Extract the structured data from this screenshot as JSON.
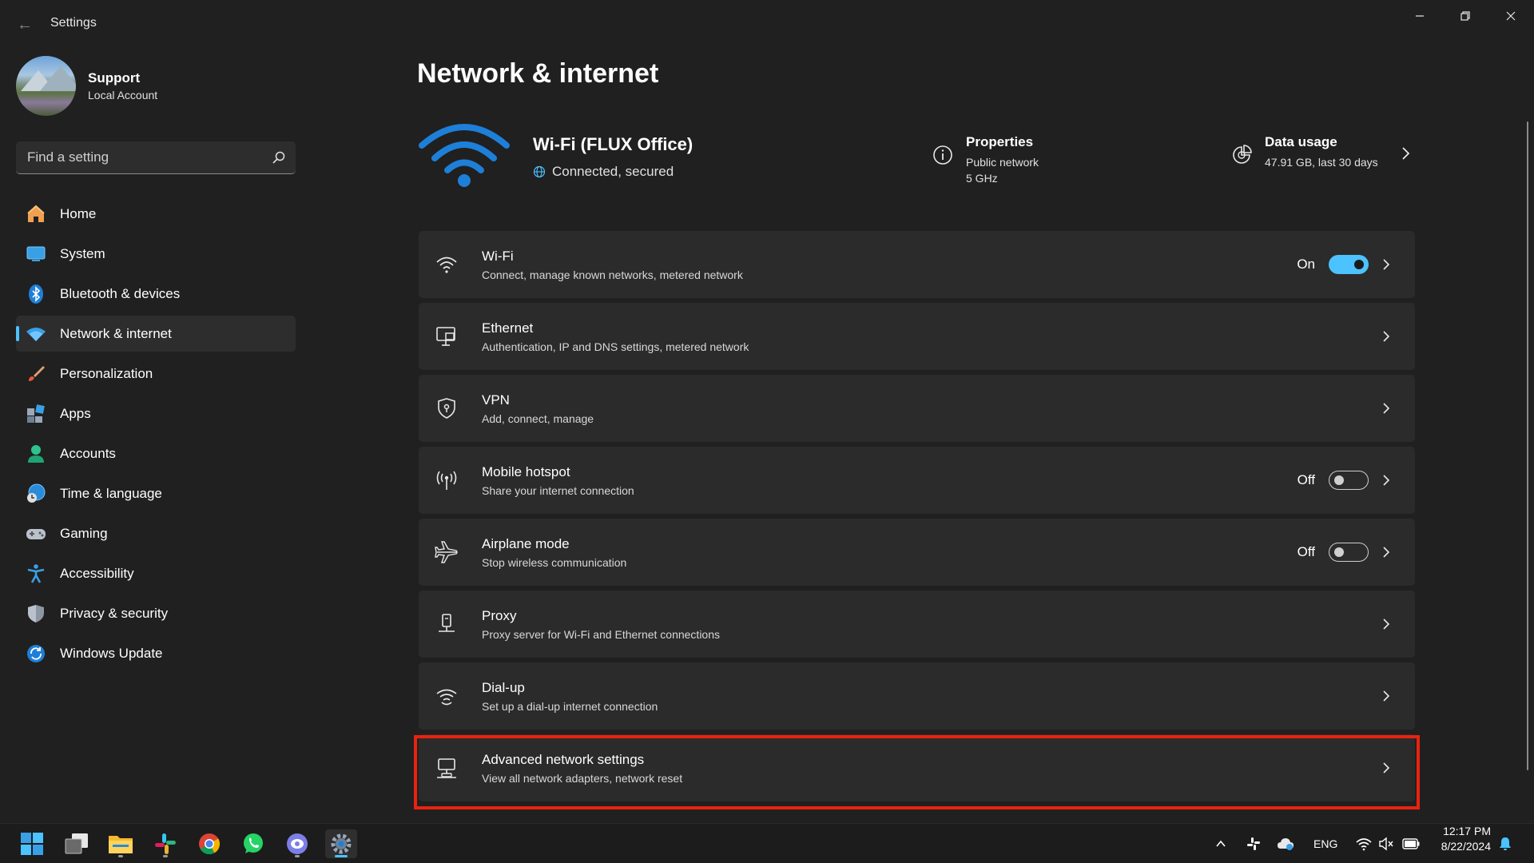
{
  "window": {
    "title": "Settings",
    "back_glyph": "←"
  },
  "profile": {
    "name": "Support",
    "account_type": "Local Account"
  },
  "search": {
    "placeholder": "Find a setting"
  },
  "sidebar": {
    "items": [
      {
        "label": "Home",
        "icon": "home-icon"
      },
      {
        "label": "System",
        "icon": "system-icon"
      },
      {
        "label": "Bluetooth & devices",
        "icon": "bluetooth-icon"
      },
      {
        "label": "Network & internet",
        "icon": "network-icon",
        "active": true
      },
      {
        "label": "Personalization",
        "icon": "brush-icon"
      },
      {
        "label": "Apps",
        "icon": "apps-icon"
      },
      {
        "label": "Accounts",
        "icon": "accounts-icon"
      },
      {
        "label": "Time & language",
        "icon": "time-language-icon"
      },
      {
        "label": "Gaming",
        "icon": "gaming-icon"
      },
      {
        "label": "Accessibility",
        "icon": "accessibility-icon"
      },
      {
        "label": "Privacy & security",
        "icon": "shield-icon"
      },
      {
        "label": "Windows Update",
        "icon": "update-icon"
      }
    ]
  },
  "main": {
    "title": "Network & internet",
    "connection": {
      "name": "Wi-Fi (FLUX Office)",
      "status": "Connected, secured"
    },
    "properties": {
      "title": "Properties",
      "network_type": "Public network",
      "band": "5 GHz"
    },
    "data_usage": {
      "title": "Data usage",
      "amount": "47.91 GB, last 30 days"
    },
    "cards": [
      {
        "title": "Wi-Fi",
        "subtitle": "Connect, manage known networks, metered network",
        "state": "On",
        "icon": "wifi-icon"
      },
      {
        "title": "Ethernet",
        "subtitle": "Authentication, IP and DNS settings, metered network",
        "icon": "ethernet-icon"
      },
      {
        "title": "VPN",
        "subtitle": "Add, connect, manage",
        "icon": "vpn-shield-icon"
      },
      {
        "title": "Mobile hotspot",
        "subtitle": "Share your internet connection",
        "state": "Off",
        "icon": "hotspot-icon"
      },
      {
        "title": "Airplane mode",
        "subtitle": "Stop wireless communication",
        "state": "Off",
        "icon": "airplane-icon"
      },
      {
        "title": "Proxy",
        "subtitle": "Proxy server for Wi-Fi and Ethernet connections",
        "icon": "proxy-icon"
      },
      {
        "title": "Dial-up",
        "subtitle": "Set up a dial-up internet connection",
        "icon": "dialup-icon"
      },
      {
        "title": "Advanced network settings",
        "subtitle": "View all network adapters, network reset",
        "icon": "advanced-network-icon"
      }
    ]
  },
  "colors": {
    "accent": "#4cc2ff",
    "highlight": "#e8230f",
    "background": "#202020",
    "card": "#2b2b2b"
  },
  "taskbar": {
    "language": "ENG",
    "time": "12:17 PM",
    "date": "8/22/2024"
  }
}
